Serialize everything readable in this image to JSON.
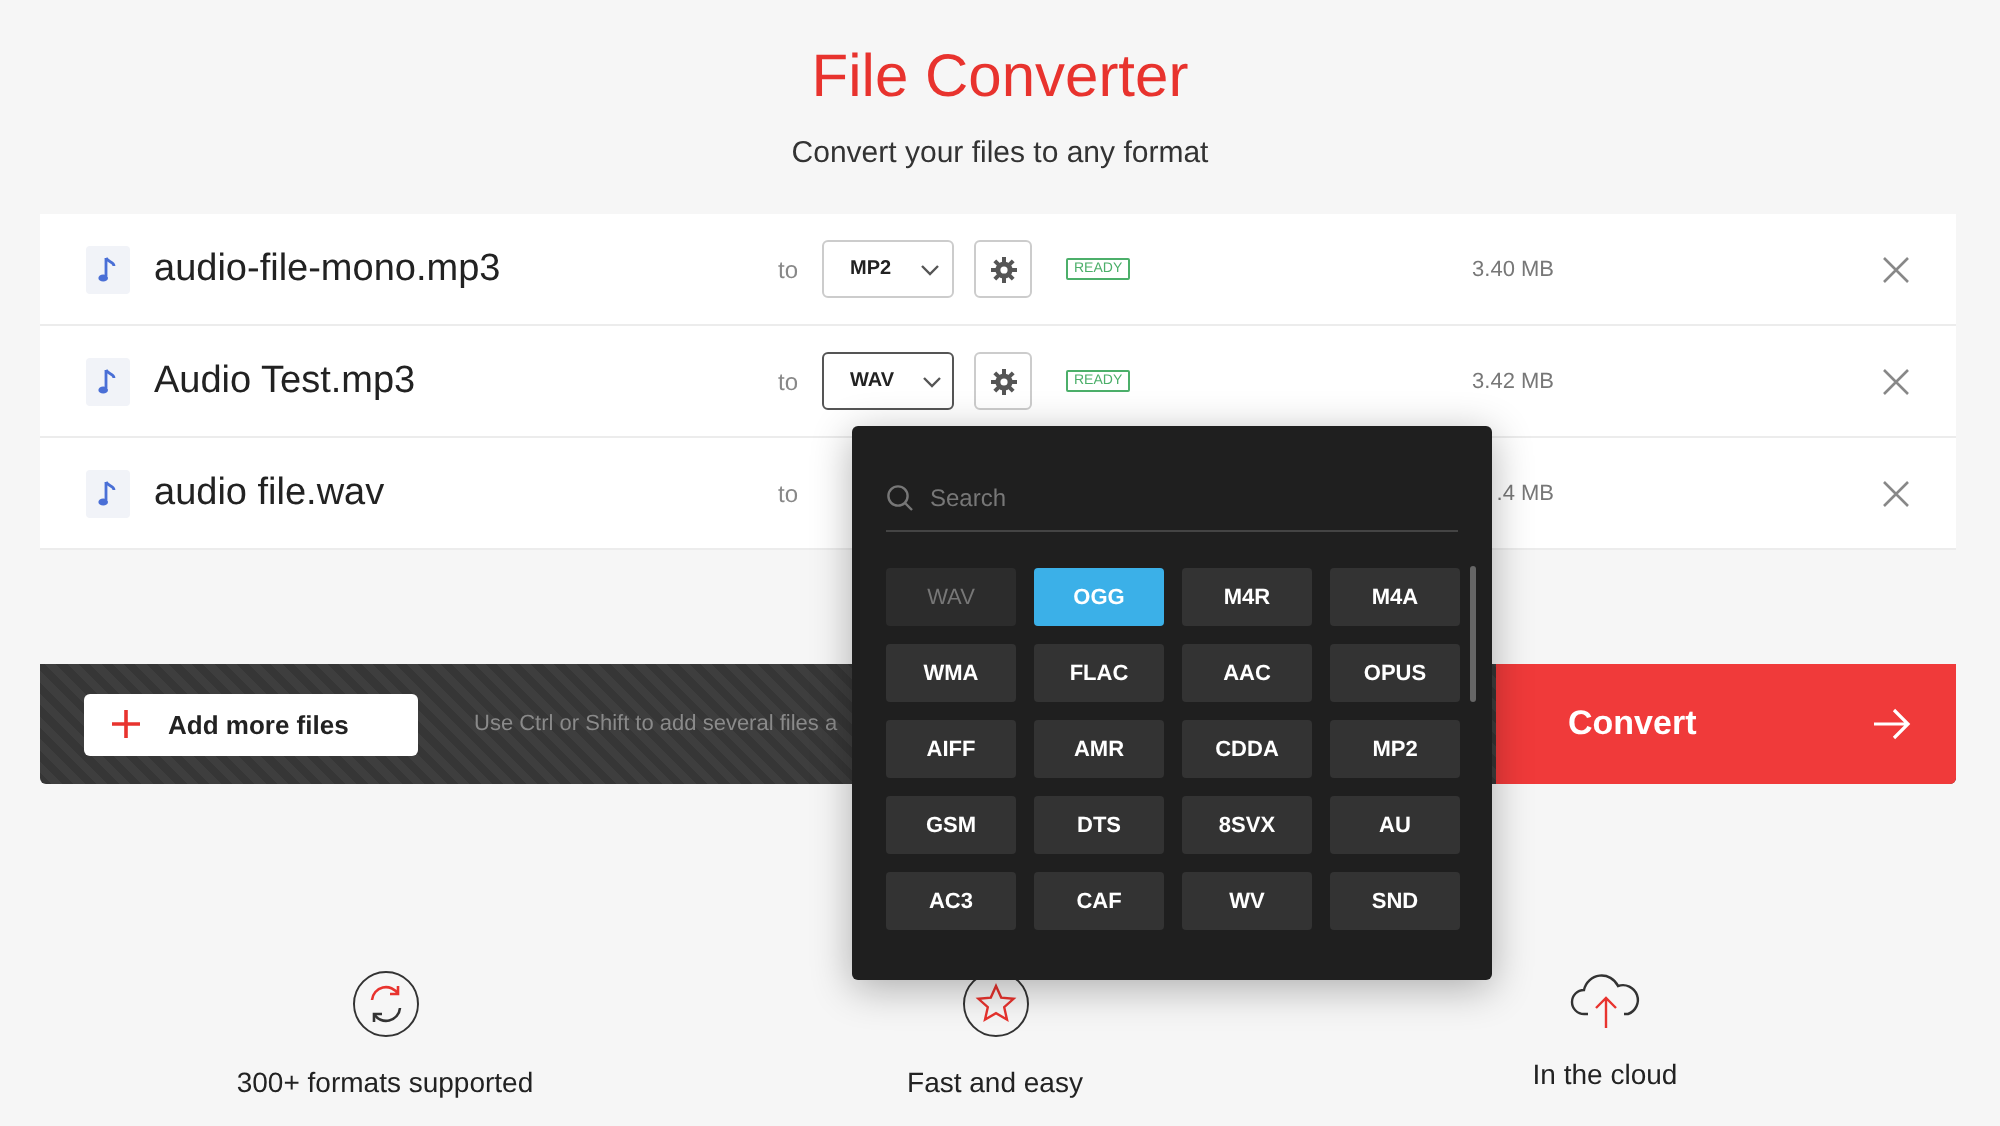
{
  "header": {
    "title": "File Converter",
    "subtitle": "Convert your files to any format"
  },
  "files": [
    {
      "name": "audio-file-mono.mp3",
      "to": "to",
      "format": "MP2",
      "open": false,
      "status": "READY",
      "size": "3.40 MB"
    },
    {
      "name": "Audio Test.mp3",
      "to": "to",
      "format": "WAV",
      "open": true,
      "status": "READY",
      "size": "3.42 MB"
    },
    {
      "name": "audio file.wav",
      "to": "to",
      "size": ".4 MB"
    }
  ],
  "bar": {
    "add_button": "Add more files",
    "hint": "Use Ctrl or Shift to add several files a",
    "convert_button": "Convert"
  },
  "format_menu": {
    "search_placeholder": "Search",
    "formats": [
      {
        "label": "WAV",
        "selected": false,
        "disabled": true
      },
      {
        "label": "OGG",
        "selected": true,
        "disabled": false
      },
      {
        "label": "M4R",
        "selected": false,
        "disabled": false
      },
      {
        "label": "M4A",
        "selected": false,
        "disabled": false
      },
      {
        "label": "WMA",
        "selected": false,
        "disabled": false
      },
      {
        "label": "FLAC",
        "selected": false,
        "disabled": false
      },
      {
        "label": "AAC",
        "selected": false,
        "disabled": false
      },
      {
        "label": "OPUS",
        "selected": false,
        "disabled": false
      },
      {
        "label": "AIFF",
        "selected": false,
        "disabled": false
      },
      {
        "label": "AMR",
        "selected": false,
        "disabled": false
      },
      {
        "label": "CDDA",
        "selected": false,
        "disabled": false
      },
      {
        "label": "MP2",
        "selected": false,
        "disabled": false
      },
      {
        "label": "GSM",
        "selected": false,
        "disabled": false
      },
      {
        "label": "DTS",
        "selected": false,
        "disabled": false
      },
      {
        "label": "8SVX",
        "selected": false,
        "disabled": false
      },
      {
        "label": "AU",
        "selected": false,
        "disabled": false
      },
      {
        "label": "AC3",
        "selected": false,
        "disabled": false
      },
      {
        "label": "CAF",
        "selected": false,
        "disabled": false
      },
      {
        "label": "WV",
        "selected": false,
        "disabled": false
      },
      {
        "label": "SND",
        "selected": false,
        "disabled": false
      }
    ]
  },
  "features": [
    {
      "kind": "formats",
      "label": "300+ formats supported"
    },
    {
      "kind": "fast",
      "label": "Fast and easy"
    },
    {
      "kind": "cloud",
      "label": "In the cloud"
    }
  ]
}
